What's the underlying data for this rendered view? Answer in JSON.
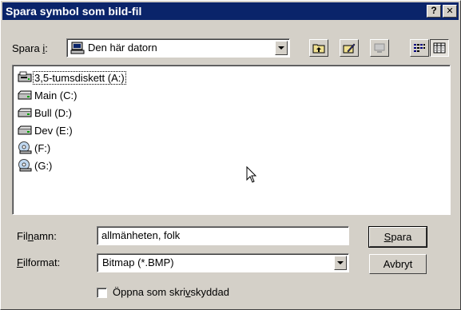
{
  "window": {
    "title": "Spara symbol som bild-fil",
    "help_glyph": "?",
    "close_glyph": "✕"
  },
  "look_in": {
    "label_pre": "Spara ",
    "label_key": "i",
    "label_post": ":",
    "value": "Den här datorn",
    "icon": "computer-icon"
  },
  "toolbar": {
    "buttons": [
      {
        "name": "up-one-level",
        "icon": "folder-up-icon"
      },
      {
        "name": "new-folder",
        "icon": "folder-edit-icon"
      },
      {
        "name": "desktop",
        "icon": "desktop-icon"
      },
      {
        "name": "list-view",
        "icon": "list-view-icon"
      },
      {
        "name": "details-view",
        "icon": "details-view-icon"
      }
    ]
  },
  "drives": [
    {
      "label": "3,5-tumsdiskett (A:)",
      "icon": "floppy-drive-icon"
    },
    {
      "label": "Main (C:)",
      "icon": "hard-drive-icon"
    },
    {
      "label": "Bull (D:)",
      "icon": "hard-drive-icon"
    },
    {
      "label": "Dev (E:)",
      "icon": "hard-drive-icon"
    },
    {
      "label": "(F:)",
      "icon": "cd-drive-icon"
    },
    {
      "label": "(G:)",
      "icon": "cd-drive-icon"
    }
  ],
  "filename": {
    "label_pre": "Fil",
    "label_key": "n",
    "label_post": "amn:",
    "value": "allmänheten, folk"
  },
  "fileformat": {
    "label_pre": "",
    "label_key": "F",
    "label_post": "ilformat:",
    "value": "Bitmap (*.BMP)"
  },
  "buttons": {
    "save_key": "S",
    "save_rest": "para",
    "cancel": "Avbryt"
  },
  "readonly": {
    "pre": "Öppna som skri",
    "key": "v",
    "post": "skyddad",
    "checked": false
  },
  "colors": {
    "title_bar": "#0a246a",
    "face": "#d4d0c8"
  }
}
